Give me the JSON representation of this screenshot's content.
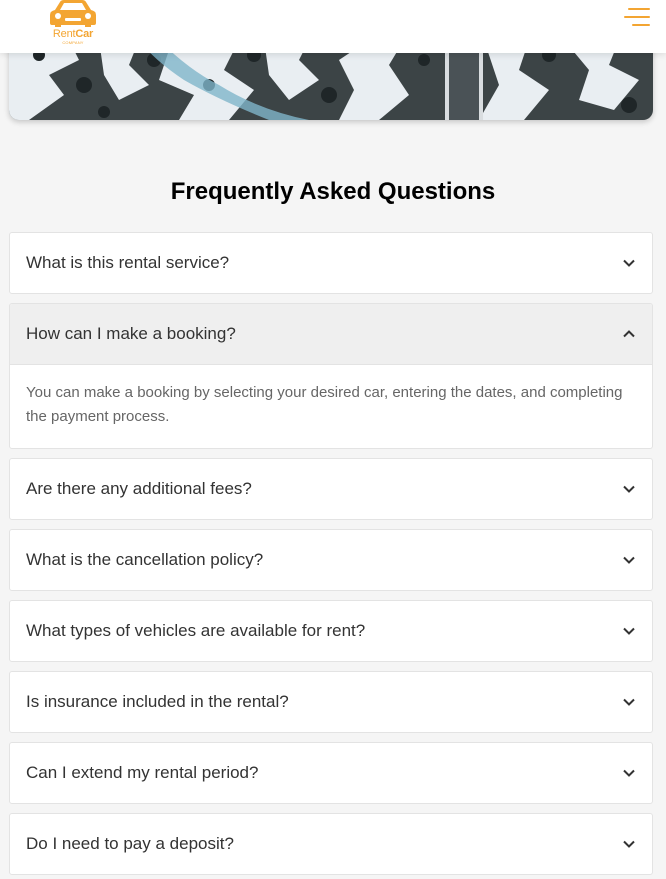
{
  "header": {
    "logo_rent": "Rent",
    "logo_car": "Car",
    "logo_sub": "COMPANY"
  },
  "faq": {
    "title": "Frequently Asked Questions",
    "items": [
      {
        "question": "What is this rental service?",
        "open": false
      },
      {
        "question": "How can I make a booking?",
        "open": true,
        "answer": "You can make a booking by selecting your desired car, entering the dates, and completing the payment process."
      },
      {
        "question": "Are there any additional fees?",
        "open": false
      },
      {
        "question": "What is the cancellation policy?",
        "open": false
      },
      {
        "question": "What types of vehicles are available for rent?",
        "open": false
      },
      {
        "question": "Is insurance included in the rental?",
        "open": false
      },
      {
        "question": "Can I extend my rental period?",
        "open": false
      },
      {
        "question": "Do I need to pay a deposit?",
        "open": false
      }
    ]
  },
  "colors": {
    "brand": "#f3a532",
    "open_header_bg": "#efefef"
  },
  "icons": {
    "logo": "car-icon",
    "menu": "hamburger-menu-icon",
    "collapsed": "chevron-down-icon",
    "expanded": "chevron-up-icon"
  }
}
